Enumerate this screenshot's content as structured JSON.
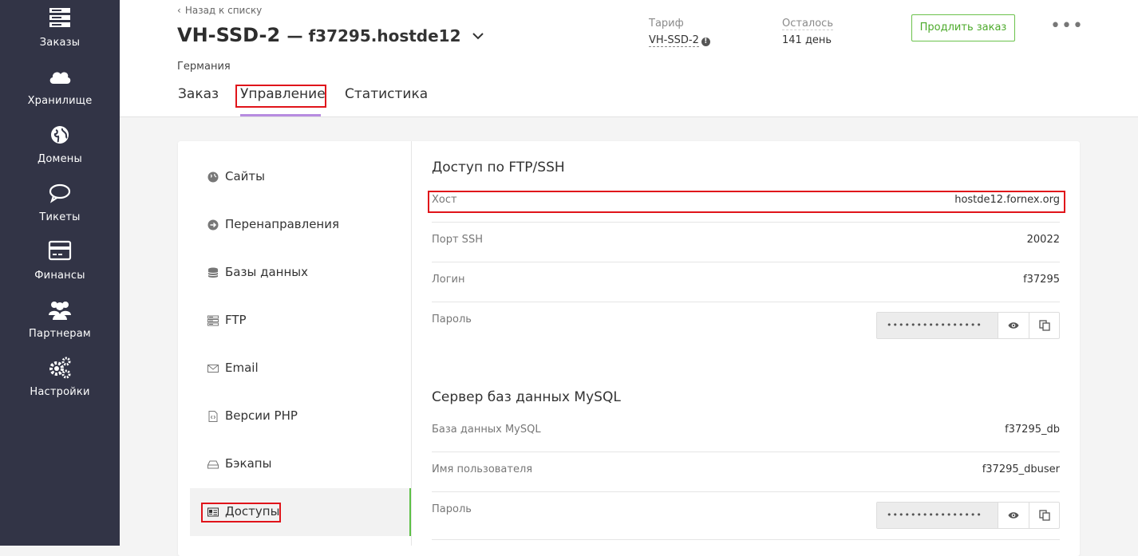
{
  "sidebar": {
    "items": [
      {
        "label": "Заказы",
        "icon": "server-icon"
      },
      {
        "label": "Хранилище",
        "icon": "cloud-icon"
      },
      {
        "label": "Домены",
        "icon": "globe-icon"
      },
      {
        "label": "Тикеты",
        "icon": "chat-icon"
      },
      {
        "label": "Финансы",
        "icon": "credit-card-icon"
      },
      {
        "label": "Партнерам",
        "icon": "users-icon"
      },
      {
        "label": "Настройки",
        "icon": "gears-icon"
      }
    ]
  },
  "header": {
    "back_link": "Назад к списку",
    "title": "VH-SSD-2",
    "subtitle": "— f37295.hostde12",
    "country": "Германия",
    "plan_label": "Тариф",
    "plan_value": "VH-SSD-2",
    "remaining_label": "Осталось",
    "remaining_value": "141 день",
    "renew_button": "Продлить заказ",
    "more_button": "•••"
  },
  "tabs": [
    {
      "label": "Заказ"
    },
    {
      "label": "Управление",
      "active": true
    },
    {
      "label": "Статистика"
    }
  ],
  "menu": {
    "items": [
      {
        "label": "Сайты",
        "icon": "globe-icon"
      },
      {
        "label": "Перенаправления",
        "icon": "arrow-circle-icon"
      },
      {
        "label": "Базы данных",
        "icon": "database-icon"
      },
      {
        "label": "FTP",
        "icon": "server-icon"
      },
      {
        "label": "Email",
        "icon": "envelope-icon"
      },
      {
        "label": "Версии PHP",
        "icon": "code-file-icon"
      },
      {
        "label": "Бэкапы",
        "icon": "hdd-icon"
      },
      {
        "label": "Доступы",
        "icon": "id-card-icon",
        "active": true
      }
    ]
  },
  "ftp_section": {
    "title": "Доступ по FTP/SSH",
    "rows": [
      {
        "key": "Хост",
        "value": "hostde12.fornex.org"
      },
      {
        "key": "Порт SSH",
        "value": "20022"
      },
      {
        "key": "Логин",
        "value": "f37295"
      },
      {
        "key": "Пароль",
        "value": "••••••••••••••••"
      }
    ]
  },
  "mysql_section": {
    "title": "Сервер баз данных MySQL",
    "rows": [
      {
        "key": "База данных MySQL",
        "value": "f37295_db"
      },
      {
        "key": "Имя пользователя",
        "value": "f37295_dbuser"
      },
      {
        "key": "Пароль",
        "value": "••••••••••••••••"
      }
    ]
  },
  "colors": {
    "sidebar_bg": "#323446",
    "accent_green": "#5cc045",
    "tab_underline": "#b78be0",
    "highlight_red": "#e0141a"
  }
}
